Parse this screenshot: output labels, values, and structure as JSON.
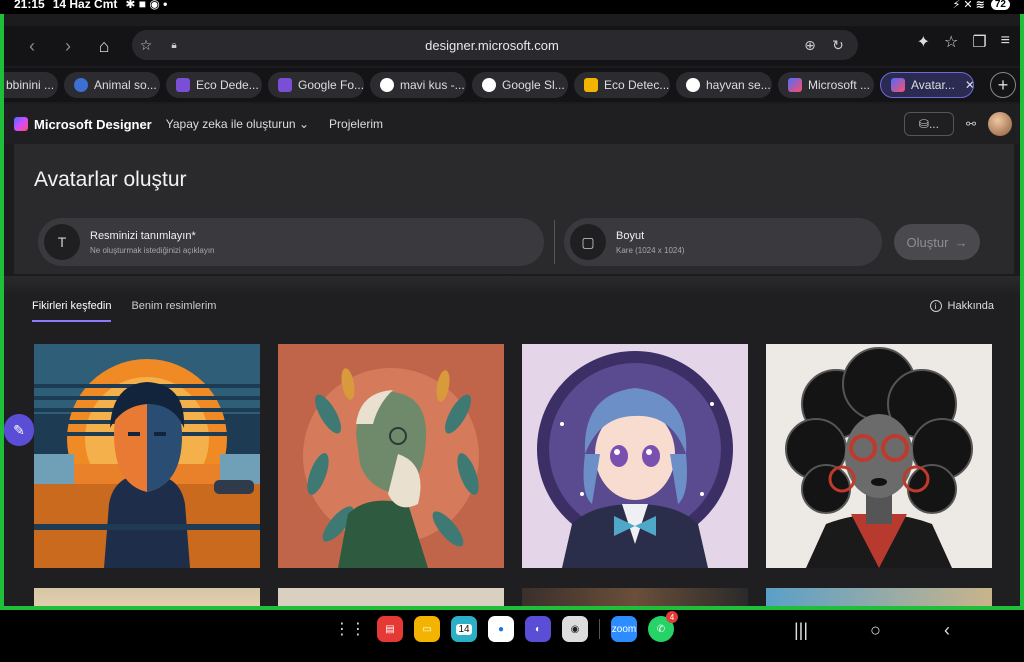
{
  "status": {
    "time": "21:15",
    "date": "14 Haz Cmt",
    "battery": "72"
  },
  "browser": {
    "url": "designer.microsoft.com",
    "tabs": [
      {
        "label": "bbinini ...",
        "color": "#333"
      },
      {
        "label": "Animal so...",
        "color": "#3b6fd1"
      },
      {
        "label": "Eco Dede...",
        "color": "#7a4fd6"
      },
      {
        "label": "Google Fo...",
        "color": "#7a4fd6"
      },
      {
        "label": "mavi kus -...",
        "color": "#ffffff"
      },
      {
        "label": "Google Sl...",
        "color": "#ffffff"
      },
      {
        "label": "Eco Detec...",
        "color": "#f2b400"
      },
      {
        "label": "hayvan se...",
        "color": "#ffffff"
      },
      {
        "label": "Microsoft ...",
        "color": "#d24bff"
      },
      {
        "label": "Avatar...",
        "color": "#d24bff"
      }
    ]
  },
  "app": {
    "name": "Microsoft Designer",
    "menu_create": "Yapay zeka ile oluşturun",
    "menu_projects": "Projelerim",
    "credits": "..."
  },
  "hero": {
    "title": "Avatarlar oluştur",
    "describe_title": "Resminizi tanımlayın*",
    "describe_sub": "Ne oluşturmak istediğinizi açıklayın",
    "size_title": "Boyut",
    "size_sub": "Kare (1024 x 1024)",
    "create_label": "Oluştur"
  },
  "content": {
    "tab_explore": "Fikirleri keşfedin",
    "tab_mine": "Benim resimlerim",
    "about": "Hakkında"
  },
  "dock": {
    "calendar_day": "14",
    "whatsapp_badge": "4"
  }
}
